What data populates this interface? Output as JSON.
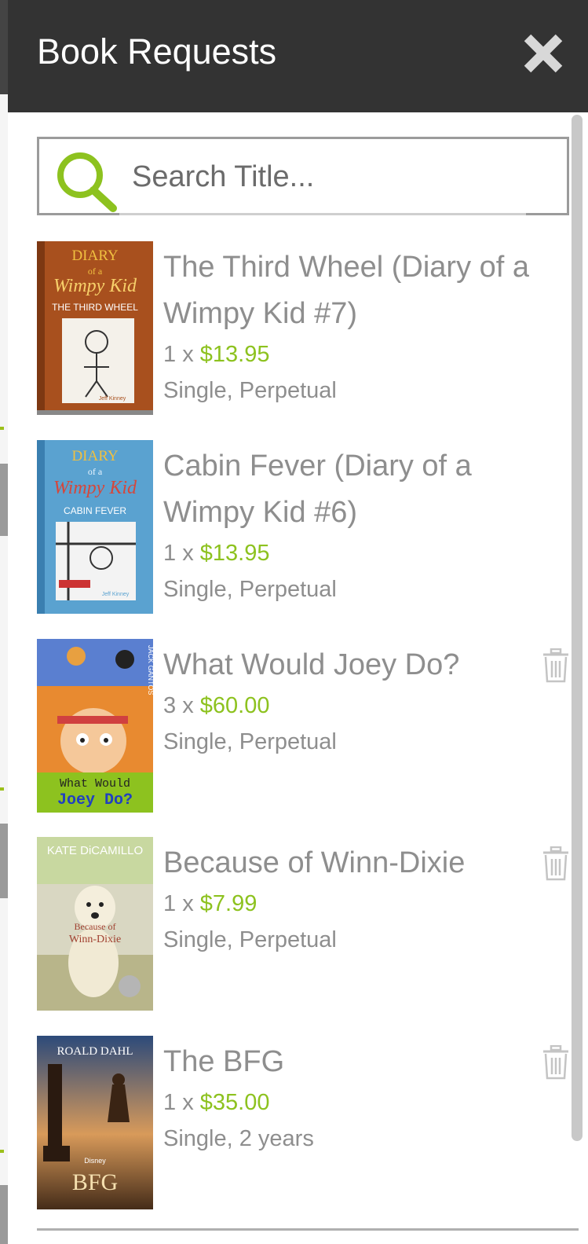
{
  "header": {
    "title": "Book Requests",
    "close_icon": "close-icon"
  },
  "search": {
    "placeholder": "Search Title...",
    "value": "",
    "icon": "search-icon"
  },
  "colors": {
    "accent": "#8dc21f",
    "header_bg": "#333333",
    "text_muted": "#8e8e8e"
  },
  "items": [
    {
      "title": "The Third Wheel (Diary of a Wimpy Kid #7)",
      "quantity": "1",
      "times": "x",
      "price": "$13.95",
      "license": "Single, Perpetual",
      "deletable": false,
      "cover": {
        "series": "DIARY",
        "of": "of a",
        "brand": "Wimpy Kid",
        "subtitle": "THE THIRD WHEEL",
        "author": "Jeff Kinney"
      }
    },
    {
      "title": "Cabin Fever (Diary of a Wimpy Kid #6)",
      "quantity": "1",
      "times": "x",
      "price": "$13.95",
      "license": "Single, Perpetual",
      "deletable": false,
      "cover": {
        "series": "DIARY",
        "of": "of a",
        "brand": "Wimpy Kid",
        "subtitle": "CABIN FEVER",
        "author": "Jeff Kinney"
      }
    },
    {
      "title": "What Would Joey Do?",
      "quantity": "3",
      "times": "x",
      "price": "$60.00",
      "license": "Single, Perpetual",
      "deletable": true,
      "cover": {
        "author": "JACK GANTOS",
        "line1": "What Would",
        "line2": "Joey Do?"
      }
    },
    {
      "title": "Because of Winn-Dixie",
      "quantity": "1",
      "times": "x",
      "price": "$7.99",
      "license": "Single, Perpetual",
      "deletable": true,
      "cover": {
        "author": "KATE DiCAMILLO",
        "line1": "Because of",
        "line2": "Winn-Dixie"
      }
    },
    {
      "title": "The BFG",
      "quantity": "1",
      "times": "x",
      "price": "$35.00",
      "license": "Single, 2 years",
      "deletable": true,
      "cover": {
        "author": "ROALD DAHL",
        "brand": "Disney",
        "line1": "BFG"
      }
    }
  ]
}
